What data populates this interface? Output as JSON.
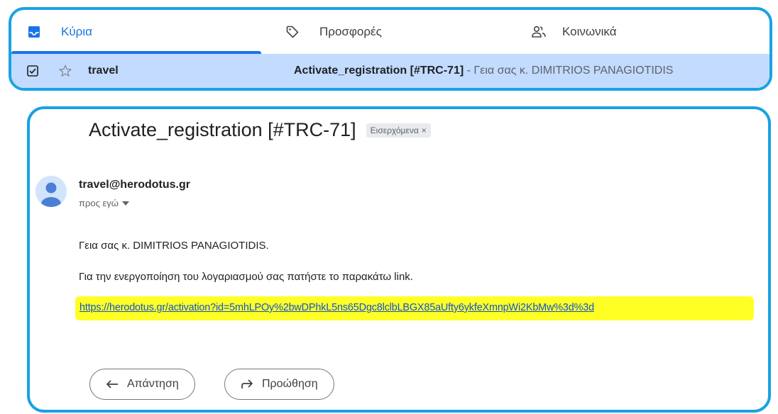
{
  "tabs": [
    {
      "label": "Κύρια",
      "icon": "inbox-icon",
      "active": true
    },
    {
      "label": "Προσφορές",
      "icon": "tag-icon",
      "active": false
    },
    {
      "label": "Κοινωνικά",
      "icon": "people-icon",
      "active": false
    }
  ],
  "inbox_row": {
    "sender": "travel",
    "subject": "Activate_registration [#TRC-71]",
    "snippet": " - Γεια σας κ. DIMITRIOS PANAGIOTIDIS"
  },
  "email": {
    "subject": "Activate_registration [#TRC-71]",
    "label": "Εισερχόμενα",
    "label_close": "×",
    "from": "travel@herodotus.gr",
    "to": "προς εγώ",
    "greeting": "Γεια σας κ. DIMITRIOS PANAGIOTIDIS.",
    "instruction": "Για την ενεργοποίηση του λογαριασμού σας πατήστε το παρακάτω link.",
    "link": "https://herodotus.gr/activation?id=5mhLPOy%2bwDPhkL5ns65Dgc8lclbLBGX85aUfty6ykfeXmnpWi2KbMw%3d%3d",
    "highlight_color": "#ffff26"
  },
  "actions": {
    "reply": "Απάντηση",
    "forward": "Προώθηση"
  },
  "colors": {
    "accent": "#1a73e8",
    "panel_border": "#1aa2e3",
    "selected_row": "#c2dbff"
  }
}
